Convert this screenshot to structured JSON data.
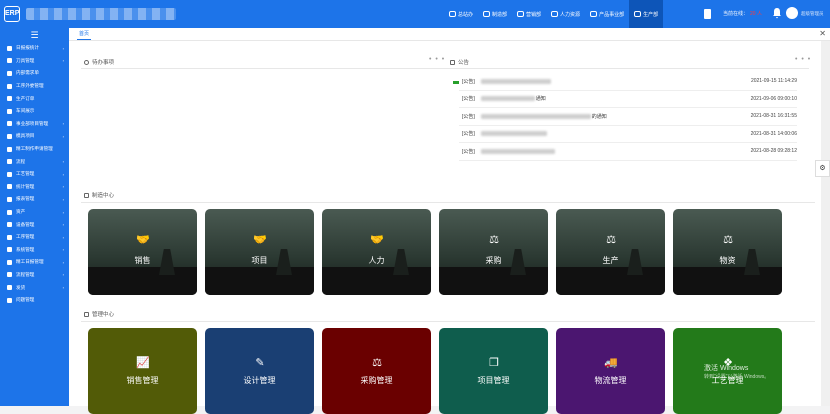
{
  "topbar": {
    "logo_text": "ERP",
    "nav": [
      {
        "label": "总站办",
        "icon": "office-icon"
      },
      {
        "label": "制造部",
        "icon": "eye-icon"
      },
      {
        "label": "营销部",
        "icon": "home-icon"
      },
      {
        "label": "人力资源",
        "icon": "users-icon"
      },
      {
        "label": "产品事业部",
        "icon": "chart-icon"
      },
      {
        "label": "生产部",
        "icon": "factory-icon"
      }
    ],
    "active_nav": 5,
    "online_label": "当前在线：",
    "online_count": "20 人",
    "user_name": "超级管理员"
  },
  "sidebar": {
    "toggle_icon": "☰",
    "items": [
      {
        "label": "日报报统计",
        "caret": true
      },
      {
        "label": "刀具管理",
        "caret": true
      },
      {
        "label": "内部需求单",
        "caret": false
      },
      {
        "label": "工序外委管理",
        "caret": false
      },
      {
        "label": "生产订单",
        "caret": false
      },
      {
        "label": "车间展示",
        "caret": false
      },
      {
        "label": "事业部项目管理",
        "caret": true
      },
      {
        "label": "模具项目",
        "caret": true
      },
      {
        "label": "精工制作申请管理",
        "caret": false
      },
      {
        "label": "流程",
        "caret": true
      },
      {
        "label": "工艺管理",
        "caret": true
      },
      {
        "label": "统计管理",
        "caret": true
      },
      {
        "label": "报表管理",
        "caret": true
      },
      {
        "label": "资产",
        "caret": true
      },
      {
        "label": "设备管理",
        "caret": true
      },
      {
        "label": "工序管理",
        "caret": true
      },
      {
        "label": "系统管理",
        "caret": true
      },
      {
        "label": "精工日报管理",
        "caret": true
      },
      {
        "label": "流程管理",
        "caret": true
      },
      {
        "label": "发货",
        "caret": true
      },
      {
        "label": "问题管理",
        "caret": false
      }
    ]
  },
  "tabs": {
    "home": "首页",
    "close_icon": "✕"
  },
  "todo": {
    "title": "待办事项",
    "more": "• • •"
  },
  "notice": {
    "title": "公告",
    "more": "• • •",
    "rows": [
      {
        "tag": "[公告]",
        "text": "",
        "date": "2021-09-15 11:14:29"
      },
      {
        "tag": "[公告]",
        "text": "通知",
        "date": "2021-09-06 09:00:10"
      },
      {
        "tag": "[公告]",
        "text": "的通知",
        "date": "2021-08-31 16:31:55"
      },
      {
        "tag": "[公告]",
        "text": "",
        "date": "2021-08-31 14:00:06"
      },
      {
        "tag": "[公告]",
        "text": "",
        "date": "2021-08-28 09:28:12"
      }
    ]
  },
  "mfg_center": {
    "title": "制造中心",
    "cards": [
      {
        "label": "销售",
        "icon": "handshake-icon"
      },
      {
        "label": "项目",
        "icon": "handshake-icon"
      },
      {
        "label": "人力",
        "icon": "handshake-icon"
      },
      {
        "label": "采购",
        "icon": "scale-icon"
      },
      {
        "label": "生产",
        "icon": "scale-icon"
      },
      {
        "label": "物资",
        "icon": "scale-icon"
      }
    ]
  },
  "mgmt_center": {
    "title": "管理中心",
    "cards": [
      {
        "label": "销售管理",
        "icon": "trend-chart-icon",
        "color": "#525b07"
      },
      {
        "label": "设计管理",
        "icon": "edit-icon",
        "color": "#1a3f73"
      },
      {
        "label": "采购管理",
        "icon": "scale-icon",
        "color": "#6a0000"
      },
      {
        "label": "项目管理",
        "icon": "windows-icon",
        "color": "#0f5d4d"
      },
      {
        "label": "物流管理",
        "icon": "truck-icon",
        "color": "#4b1670"
      },
      {
        "label": "工艺管理",
        "icon": "dropbox-icon",
        "color": "#237a1a"
      }
    ]
  },
  "watermark": {
    "line1": "激活 Windows",
    "line2": "转到\"设置\"以激活 Windows。"
  }
}
